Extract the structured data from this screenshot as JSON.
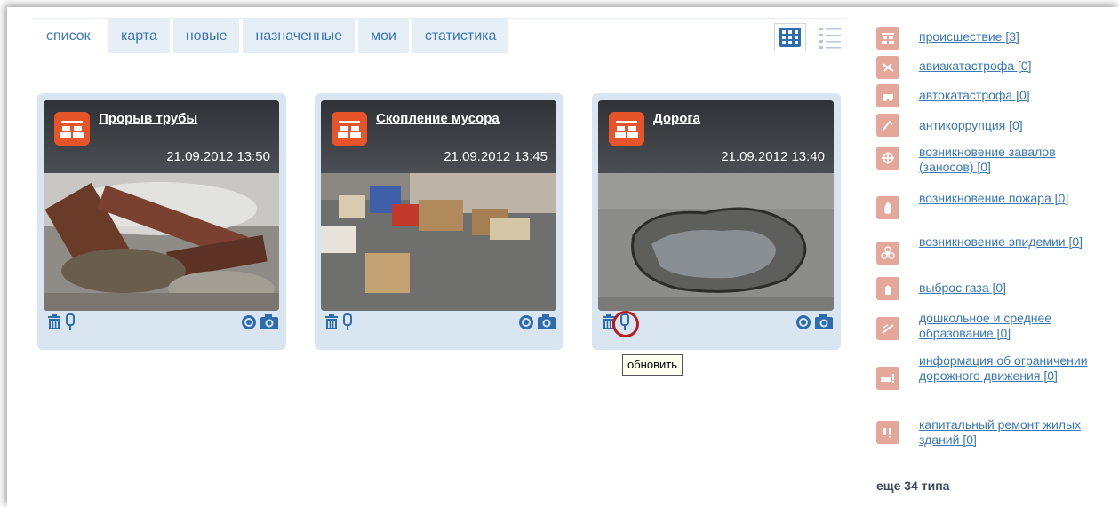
{
  "tabs": [
    {
      "label": "список",
      "active": true
    },
    {
      "label": "карта",
      "active": false
    },
    {
      "label": "новые",
      "active": false
    },
    {
      "label": "назначенные",
      "active": false
    },
    {
      "label": "мои",
      "active": false
    },
    {
      "label": "статистика",
      "active": false
    }
  ],
  "view_modes": [
    {
      "icon": "grid-view-icon",
      "active": true
    },
    {
      "icon": "list-view-icon",
      "active": false
    }
  ],
  "cards": [
    {
      "title": "Прорыв трубы",
      "datetime": "21.09.2012 13:50",
      "photo": "burst-pipe"
    },
    {
      "title": "Скопление мусора",
      "datetime": "21.09.2012 13:45",
      "photo": "trash-pile"
    },
    {
      "title": "Дорога",
      "datetime": "21.09.2012 13:40",
      "photo": "pothole"
    }
  ],
  "card_tools": {
    "left": [
      "trash-icon",
      "pin-icon"
    ],
    "right": [
      "target-icon",
      "camera-icon"
    ]
  },
  "tooltip": {
    "text": "обновить"
  },
  "categories": [
    {
      "label": "происшествие [3]",
      "icon": "incident-icon"
    },
    {
      "label": "авиакатастрофа [0]",
      "icon": "plane-crash-icon"
    },
    {
      "label": "автокатастрофа [0]",
      "icon": "car-crash-icon"
    },
    {
      "label": "антикоррупция [0]",
      "icon": "anticorruption-icon"
    },
    {
      "label": "возникновение завалов (заносов) [0]",
      "icon": "blockage-icon"
    },
    {
      "label": "возникновение пожара [0]",
      "icon": "fire-icon"
    },
    {
      "label": "возникновение эпидемии [0]",
      "icon": "biohazard-icon"
    },
    {
      "label": "выброс газа [0]",
      "icon": "gas-icon"
    },
    {
      "label": "дошкольное и среднее образование [0]",
      "icon": "education-icon"
    },
    {
      "label": "информация об ограничении дорожного движения [0]",
      "icon": "traffic-icon"
    },
    {
      "label": "капитальный ремонт жилых зданий [0]",
      "icon": "repair-icon"
    }
  ],
  "more_link": "еще 34 типа",
  "colors": {
    "accent": "#3a77b7",
    "tab_bg": "#e6eef6",
    "card_bg": "#d9e6f1",
    "badge": "#e8542a",
    "category_icon": "#e5a79a"
  }
}
